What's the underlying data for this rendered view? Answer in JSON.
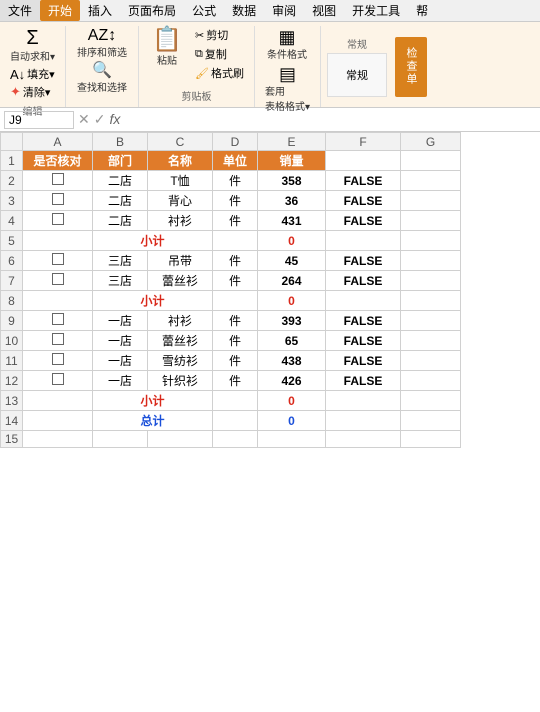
{
  "menubar": {
    "items": [
      "文件",
      "开始",
      "插入",
      "页面布局",
      "公式",
      "数据",
      "审阅",
      "视图",
      "开发工具",
      "帮"
    ]
  },
  "ribbon": {
    "groups": [
      {
        "label": "编辑",
        "buttons": [
          "自动求和▾",
          "填充▾",
          "清除▾",
          "排序和筛选",
          "查找和选择"
        ]
      },
      {
        "label": "剪贴板",
        "buttons": [
          "粘贴",
          "剪切",
          "复制",
          "格式刷"
        ]
      }
    ],
    "check_single": "检查单"
  },
  "formula_bar": {
    "cell_ref": "J9",
    "formula": ""
  },
  "columns": [
    "A",
    "B",
    "C",
    "D",
    "E",
    "F",
    "G"
  ],
  "headers": [
    "是否核对",
    "部门",
    "名称",
    "单位",
    "销量",
    "",
    ""
  ],
  "rows": [
    {
      "row": "1",
      "a_header": true,
      "b_header": true,
      "c_header": true,
      "d_header": true,
      "e_header": true
    },
    {
      "row": "2",
      "a": "☐",
      "b": "二店",
      "c": "T恤",
      "d": "件",
      "e": "358",
      "f": "FALSE"
    },
    {
      "row": "3",
      "a": "☐",
      "b": "二店",
      "c": "背心",
      "d": "件",
      "e": "36",
      "f": "FALSE"
    },
    {
      "row": "4",
      "a": "☐",
      "b": "二店",
      "c": "衬衫",
      "d": "件",
      "e": "431",
      "f": "FALSE"
    },
    {
      "row": "5",
      "subtotal": true,
      "label": "小计",
      "value": "0"
    },
    {
      "row": "6",
      "a": "☐",
      "b": "三店",
      "c": "吊带",
      "d": "件",
      "e": "45",
      "f": "FALSE"
    },
    {
      "row": "7",
      "a": "☐",
      "b": "三店",
      "c": "蕾丝衫",
      "d": "件",
      "e": "264",
      "f": "FALSE"
    },
    {
      "row": "8",
      "subtotal": true,
      "label": "小计",
      "value": "0"
    },
    {
      "row": "9",
      "a": "☐",
      "b": "一店",
      "c": "衬衫",
      "d": "件",
      "e": "393",
      "f": "FALSE"
    },
    {
      "row": "10",
      "a": "☐",
      "b": "一店",
      "c": "蕾丝衫",
      "d": "件",
      "e": "65",
      "f": "FALSE"
    },
    {
      "row": "11",
      "a": "☐",
      "b": "一店",
      "c": "雪纺衫",
      "d": "件",
      "e": "438",
      "f": "FALSE"
    },
    {
      "row": "12",
      "a": "☐",
      "b": "一店",
      "c": "针织衫",
      "d": "件",
      "e": "426",
      "f": "FALSE"
    },
    {
      "row": "13",
      "subtotal": true,
      "label": "小计",
      "value": "0"
    },
    {
      "row": "14",
      "total": true,
      "label": "总计",
      "value": "0"
    },
    {
      "row": "15",
      "empty": true
    }
  ]
}
